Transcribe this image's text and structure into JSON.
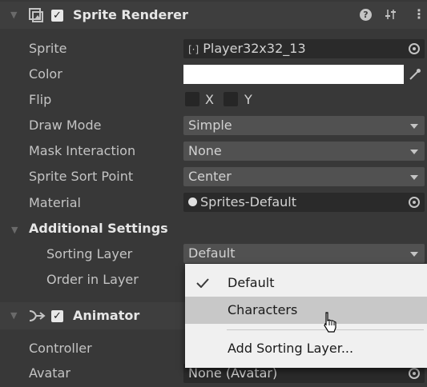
{
  "sprite_renderer": {
    "title": "Sprite Renderer",
    "sprite_label": "Sprite",
    "sprite_value": "Player32x32_13",
    "color_label": "Color",
    "color_value": "#ffffff",
    "flip_label": "Flip",
    "flip_x": "X",
    "flip_y": "Y",
    "draw_mode_label": "Draw Mode",
    "draw_mode_value": "Simple",
    "mask_label": "Mask Interaction",
    "mask_value": "None",
    "sort_point_label": "Sprite Sort Point",
    "sort_point_value": "Center",
    "material_label": "Material",
    "material_value": "Sprites-Default",
    "additional_settings_label": "Additional Settings",
    "sorting_layer_label": "Sorting Layer",
    "sorting_layer_value": "Default",
    "order_label": "Order in Layer"
  },
  "animator": {
    "title": "Animator",
    "controller_label": "Controller",
    "avatar_label": "Avatar",
    "avatar_value": "None (Avatar)"
  },
  "sorting_menu": {
    "items": [
      {
        "label": "Default",
        "checked": true
      },
      {
        "label": "Characters",
        "checked": false
      },
      {
        "label": "Add Sorting Layer...",
        "checked": false
      }
    ]
  },
  "colors": {
    "panel": "#383838",
    "header": "#3e3e3e",
    "field": "#2a2a2a",
    "popup": "#515151",
    "menu": "#f0f0f0",
    "menu_highlight": "#c8c8c8"
  }
}
